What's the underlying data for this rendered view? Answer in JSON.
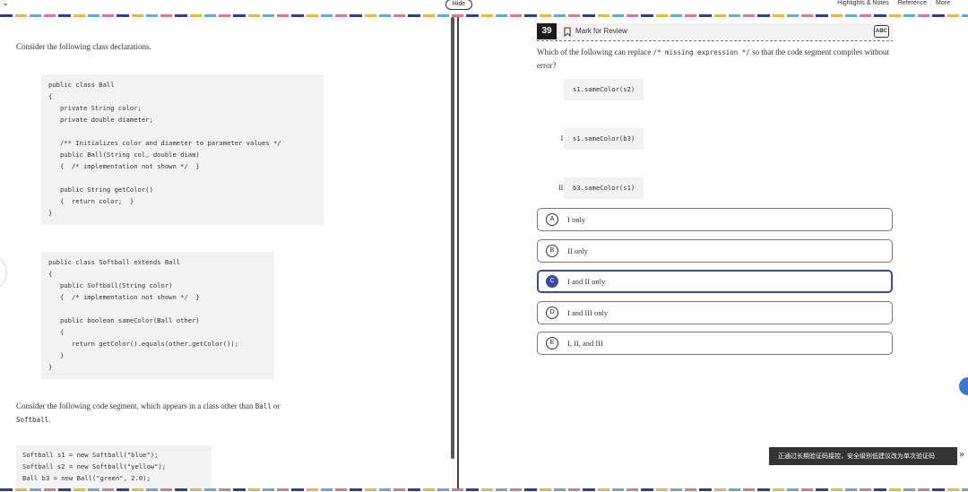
{
  "topbar": {
    "collapse_glyph": "⌄",
    "hide_label": "Hide",
    "links": [
      "Highlights & Notes",
      "Reference",
      "More"
    ]
  },
  "passage": {
    "intro": "Consider the following class declarations.",
    "class_ball": [
      "public class Ball",
      "{",
      "   private String color;",
      "   private double diameter;",
      "",
      "   /** Initializes color and diameter to parameter values */",
      "   public Ball(String col, double diam)",
      "   {  /* implementation not shown */  }",
      "",
      "   public String getColor()",
      "   {  return color;  }",
      "}"
    ],
    "class_softball": [
      "public class Softball extends Ball",
      "{",
      "   public Softball(String color)",
      "   {  /* implementation not shown */  }",
      "",
      "   public boolean sameColor(Ball other)",
      "   {",
      "      return getColor().equals(other.getColor());",
      "   }",
      "}"
    ],
    "segment_intro_1": "Consider the following code segment, which appears in a class other than ",
    "segment_code_ball": "Ball",
    "segment_intro_or": " or",
    "segment_code_softball": "Softball",
    "segment_intro_end": ".",
    "segment": [
      "Softball s1 = new Softball(\"blue\");",
      "Softball s2 = new Softball(\"yellow\");",
      "Ball b3 = new Ball(\"green\", 2.0);"
    ]
  },
  "question": {
    "number": "39",
    "mark_label": "Mark for Review",
    "abc_label": "ABC",
    "text_1": "Which of the following can replace ",
    "text_code": "/* missing expression */",
    "text_2": " so that the code segment compiles without error?",
    "options": [
      {
        "roman": "I.",
        "code": "s1.sameColor(s2)"
      },
      {
        "roman": "II.",
        "code": "s1.sameColor(b3)"
      },
      {
        "roman": "III.",
        "code": "b3.sameColor(s1)"
      }
    ],
    "choices": [
      {
        "letter": "A",
        "text": "I only",
        "selected": false
      },
      {
        "letter": "B",
        "text": "II only",
        "selected": false
      },
      {
        "letter": "C",
        "text": "I and II only",
        "selected": true
      },
      {
        "letter": "D",
        "text": "I and III only",
        "selected": false
      },
      {
        "letter": "E",
        "text": "I, II, and III",
        "selected": false
      }
    ]
  },
  "toast": {
    "text": "正通过长期验证码接控，安全级别低建议改为单次验证码",
    "chevron": "»"
  },
  "side_button_glyph": "‹",
  "colors": {
    "accent": "#3b4a9c",
    "question_number_bg": "#1b1b1b",
    "code_bg": "#f2f2f2"
  }
}
